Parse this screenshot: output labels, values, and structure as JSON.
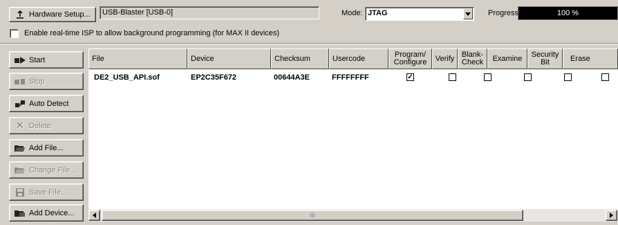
{
  "toolbar": {
    "hardware_setup_label": "Hardware Setup...",
    "hardware_value": "USB-Blaster [USB-0]",
    "mode_label": "Mode:",
    "mode_value": "JTAG",
    "progress_label": "Progress:",
    "progress_text": "100 %",
    "progress_percent": 100
  },
  "isp_option": {
    "label": "Enable real-time ISP to allow background programming (for MAX II devices)",
    "checked": false
  },
  "side_buttons": [
    {
      "label": "Start",
      "icon": "start-icon",
      "enabled": true
    },
    {
      "label": "Stop",
      "icon": "stop-icon",
      "enabled": false
    },
    {
      "label": "Auto Detect",
      "icon": "auto-detect-icon",
      "enabled": true
    },
    {
      "label": "Delete",
      "icon": "delete-icon",
      "enabled": false
    },
    {
      "label": "Add File...",
      "icon": "add-file-icon",
      "enabled": true
    },
    {
      "label": "Change File...",
      "icon": "change-file-icon",
      "enabled": false
    },
    {
      "label": "Save File...",
      "icon": "save-file-icon",
      "enabled": false
    },
    {
      "label": "Add Device...",
      "icon": "add-device-icon",
      "enabled": true
    }
  ],
  "table": {
    "columns": [
      "File",
      "Device",
      "Checksum",
      "Usercode",
      "Program/\nConfigure",
      "Verify",
      "Blank-\nCheck",
      "Examine",
      "Security\nBit",
      "Erase"
    ],
    "rows": [
      {
        "file": "DE2_USB_API.sof",
        "device": "EP2C35F672",
        "checksum": "00644A3E",
        "usercode": "FFFFFFFF",
        "program": true,
        "verify": false,
        "blank_check": false,
        "examine": false,
        "security_bit": false,
        "erase": false
      }
    ],
    "scroll_thumb_glyph": "III"
  }
}
